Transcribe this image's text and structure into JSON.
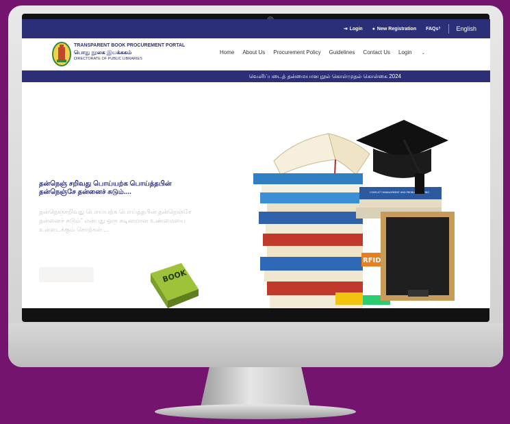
{
  "topbar": {
    "login": "Login",
    "new_registration": "New Registration",
    "faqs": "FAQs",
    "language": "English"
  },
  "brand": {
    "title": "TRANSPARENT BOOK PROCUREMENT PORTAL",
    "tamil_name": "பொது நூலக இயக்ககம்",
    "subtitle": "DIRECTORATE OF PUBLIC LIBRARIES"
  },
  "nav": {
    "items": [
      "Home",
      "About Us",
      "Procurement Policy",
      "Guidelines",
      "Contact Us"
    ],
    "login": "Login"
  },
  "marquee": {
    "text": "வெளிப்படைத் தன்மையான நூல் கொள்முதல் கொள்கை 2024"
  },
  "hero": {
    "title_line1": "தன்நெஞ் சறிவது பொய்யற்க பொய்த்தபின்",
    "title_line2": "தன்நெஞ்சே தன்னைச் சுடும்....",
    "body": "தன்நெஞ்சறிவது பொய்யற்க பொய்த்தபின் தன்நெஞ்சே தன்னைச் சுடும்\" என்பது ஒரு கடினமான உண்மையை உள்ளடக்கும் சொற்கள்....",
    "book_label": "BOOK",
    "rfid_label": "RFID",
    "book_spine_text": "CONFLICT MANAGEMENT AND PROBLEM SOLVING"
  },
  "colors": {
    "brand_blue": "#2b2f77",
    "background": "#74146f"
  }
}
